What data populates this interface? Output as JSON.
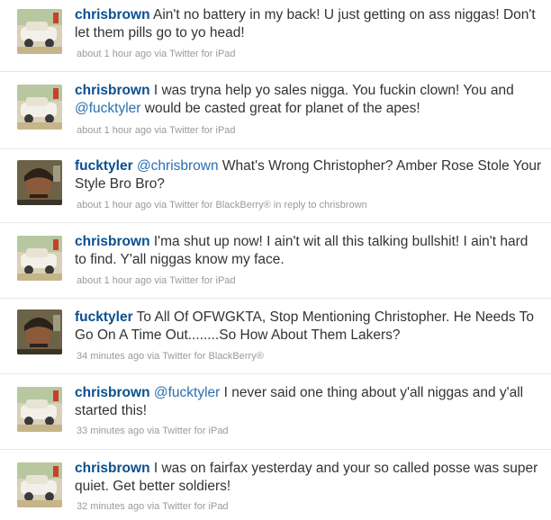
{
  "tweets": [
    {
      "user": "chrisbrown",
      "avatar": "car-avatar",
      "text_parts": [
        "Ain't no battery in my back! U just getting on ass niggas! Don't let them pills go to yo head!"
      ],
      "meta": "about 1 hour ago via Twitter for iPad"
    },
    {
      "user": "chrisbrown",
      "avatar": "car-avatar",
      "text_parts": [
        "I was tryna help yo sales nigga. You fuckin clown! You and ",
        "@fucktyler",
        " would be casted great for planet of the apes!"
      ],
      "meta": "about 1 hour ago via Twitter for iPad"
    },
    {
      "user": "fucktyler",
      "avatar": "face-avatar",
      "text_parts": [
        "@chrisbrown",
        " What's Wrong Christopher? Amber Rose Stole Your Style Bro Bro?"
      ],
      "meta": "about 1 hour ago via Twitter for BlackBerry® in reply to chrisbrown"
    },
    {
      "user": "chrisbrown",
      "avatar": "car-avatar",
      "text_parts": [
        "I'ma shut up now! I ain't wit all this talking bullshit! I ain't hard to find. Y'all niggas know my face."
      ],
      "meta": "about 1 hour ago via Twitter for iPad"
    },
    {
      "user": "fucktyler",
      "avatar": "face-avatar",
      "text_parts": [
        "To All Of OFWGKTA, Stop Mentioning Christopher. He Needs To Go On A Time Out........So How About Them Lakers?"
      ],
      "meta": "34 minutes ago via Twitter for BlackBerry®"
    },
    {
      "user": "chrisbrown",
      "avatar": "car-avatar",
      "text_parts": [
        "@fucktyler",
        " I never said one thing about y'all niggas and y'all started this!"
      ],
      "meta": "33 minutes ago via Twitter for iPad"
    },
    {
      "user": "chrisbrown",
      "avatar": "car-avatar",
      "text_parts": [
        "I was on fairfax yesterday and your so called posse was super quiet. Get better soldiers!"
      ],
      "meta": "32 minutes ago via Twitter for iPad"
    }
  ],
  "colors": {
    "username": "#0a4f8f",
    "text": "#333333",
    "meta": "#9a9a9a",
    "divider": "#e6e6e6"
  }
}
